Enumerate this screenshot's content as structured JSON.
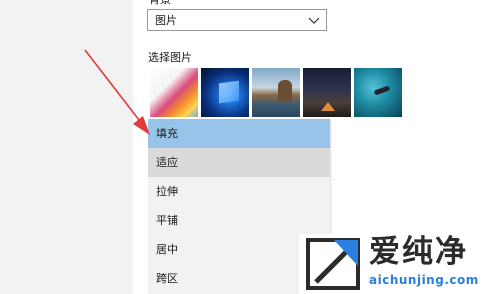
{
  "background": {
    "label": "背景",
    "select_value": "图片"
  },
  "choose_picture": {
    "label": "选择图片",
    "thumbnails": [
      {
        "name": "abstract-color-swirl"
      },
      {
        "name": "windows-logo-blue"
      },
      {
        "name": "rock-beach-sunset"
      },
      {
        "name": "starry-night-tent"
      },
      {
        "name": "underwater-diver"
      }
    ]
  },
  "fit_menu": {
    "items": [
      {
        "label": "填充",
        "state": "selected"
      },
      {
        "label": "适应",
        "state": "hover"
      },
      {
        "label": "拉伸",
        "state": "normal"
      },
      {
        "label": "平铺",
        "state": "normal"
      },
      {
        "label": "居中",
        "state": "normal"
      },
      {
        "label": "跨区",
        "state": "normal"
      }
    ]
  },
  "watermark": {
    "cn_text": "爱纯净",
    "url": "aichunjing.com"
  },
  "colors": {
    "selected": "#99c4ea",
    "hover": "#dadada",
    "menu_bg": "#f2f2f2",
    "arrow": "#e23a3a",
    "watermark_blue": "#2a7fe0"
  }
}
